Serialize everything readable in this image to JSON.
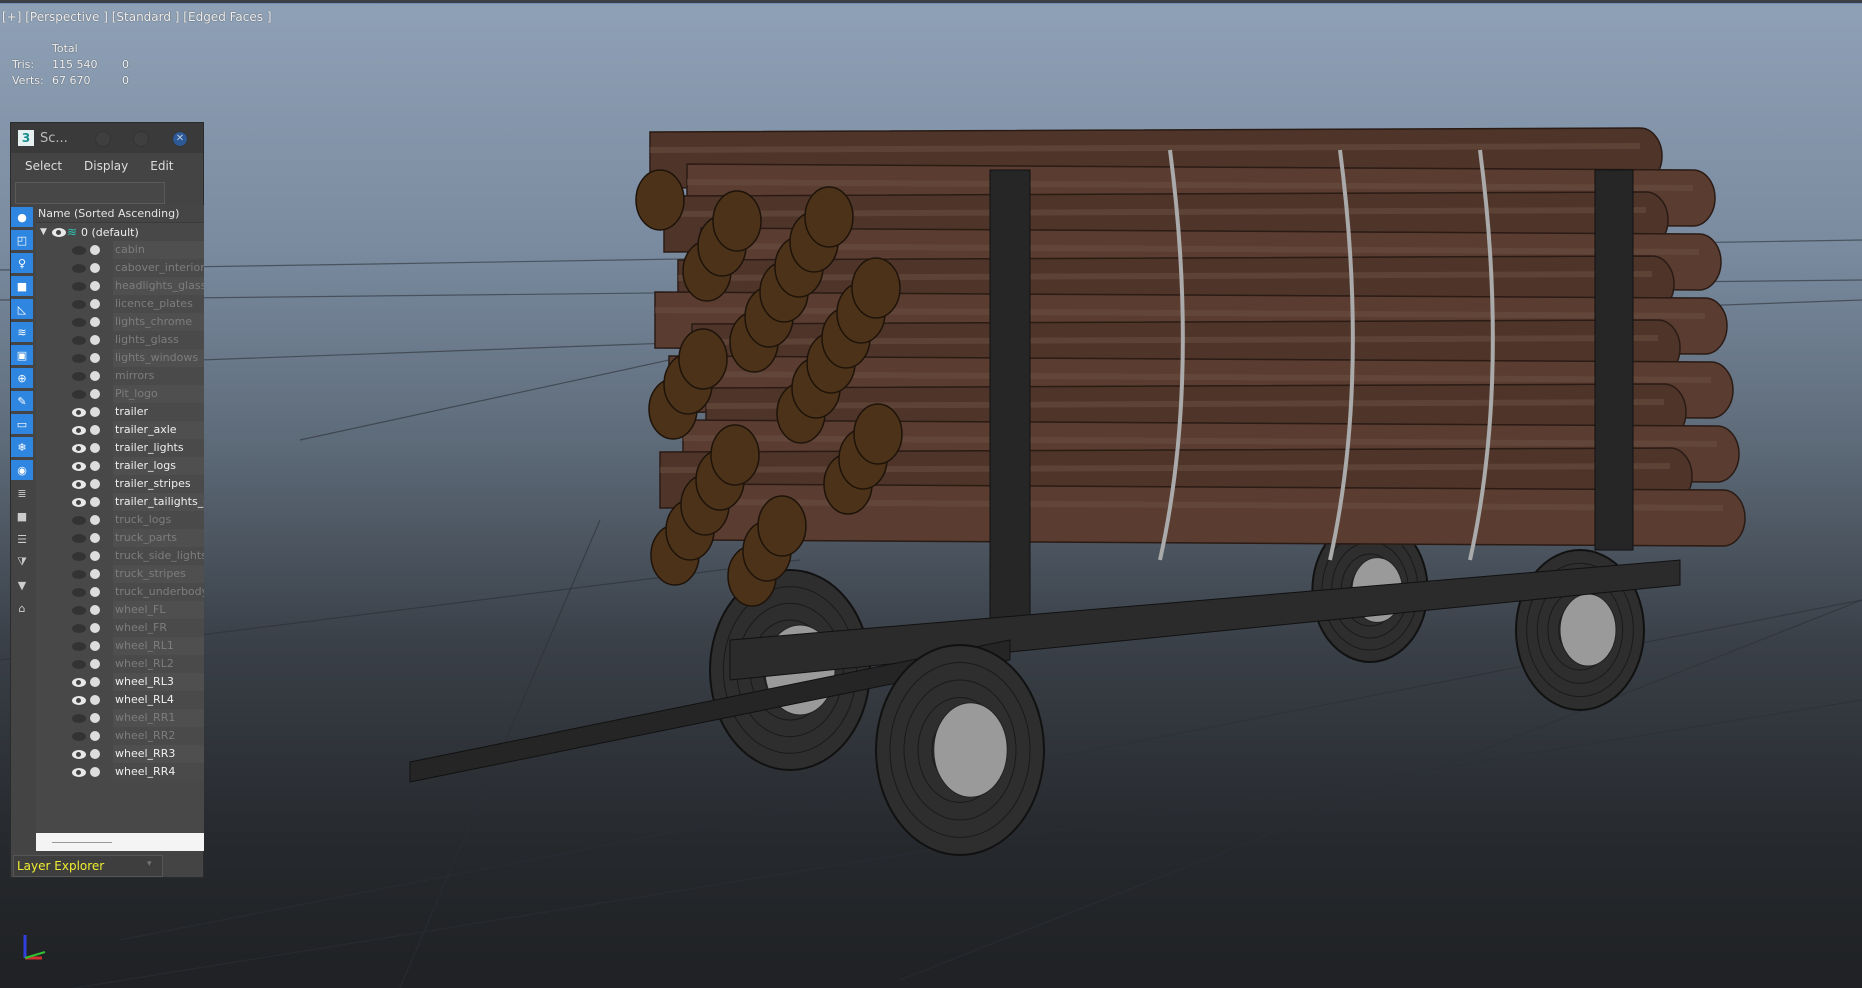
{
  "viewport": {
    "label": "[+] [Perspective ] [Standard ] [Edged Faces ]",
    "stats": {
      "header": "Total",
      "rows": [
        {
          "label": "Tris:",
          "total": "115 540",
          "sel": "0"
        },
        {
          "label": "Verts:",
          "total": "67 670",
          "sel": "0"
        }
      ]
    }
  },
  "panel": {
    "title": "Sc...",
    "logo": "3",
    "menu": [
      "Select",
      "Display",
      "Edit"
    ],
    "search_placeholder": "",
    "column_header": "Name (Sorted Ascending)",
    "root": "0 (default)",
    "layers": [
      {
        "name": "cabin",
        "visible": false
      },
      {
        "name": "cabover_interior",
        "visible": false
      },
      {
        "name": "headlights_glass",
        "visible": false
      },
      {
        "name": "licence_plates",
        "visible": false
      },
      {
        "name": "lights_chrome",
        "visible": false
      },
      {
        "name": "lights_glass",
        "visible": false
      },
      {
        "name": "lights_windows",
        "visible": false
      },
      {
        "name": "mirrors",
        "visible": false
      },
      {
        "name": "Pit_logo",
        "visible": false
      },
      {
        "name": "trailer",
        "visible": true
      },
      {
        "name": "trailer_axle",
        "visible": true
      },
      {
        "name": "trailer_lights",
        "visible": true
      },
      {
        "name": "trailer_logs",
        "visible": true
      },
      {
        "name": "trailer_stripes",
        "visible": true
      },
      {
        "name": "trailer_tailights_chrome",
        "visible": true
      },
      {
        "name": "truck_logs",
        "visible": false
      },
      {
        "name": "truck_parts",
        "visible": false
      },
      {
        "name": "truck_side_lights",
        "visible": false
      },
      {
        "name": "truck_stripes",
        "visible": false
      },
      {
        "name": "truck_underbody",
        "visible": false
      },
      {
        "name": "wheel_FL",
        "visible": false
      },
      {
        "name": "wheel_FR",
        "visible": false
      },
      {
        "name": "wheel_RL1",
        "visible": false
      },
      {
        "name": "wheel_RL2",
        "visible": false
      },
      {
        "name": "wheel_RL3",
        "visible": true
      },
      {
        "name": "wheel_RL4",
        "visible": true
      },
      {
        "name": "wheel_RR1",
        "visible": false
      },
      {
        "name": "wheel_RR2",
        "visible": false
      },
      {
        "name": "wheel_RR3",
        "visible": true
      },
      {
        "name": "wheel_RR4",
        "visible": true
      }
    ],
    "explorer_select": "Layer Explorer",
    "tool_icons": [
      "sphere-icon",
      "shapes-icon",
      "light-icon",
      "camera-icon",
      "helper-icon",
      "spacewarp-icon",
      "group-icon",
      "xref-icon",
      "bone-icon",
      "container-icon",
      "frozen-icon",
      "visibility-icon"
    ]
  },
  "colors": {
    "accent": "#2f86e0",
    "explorer_text": "#f0ee30"
  }
}
